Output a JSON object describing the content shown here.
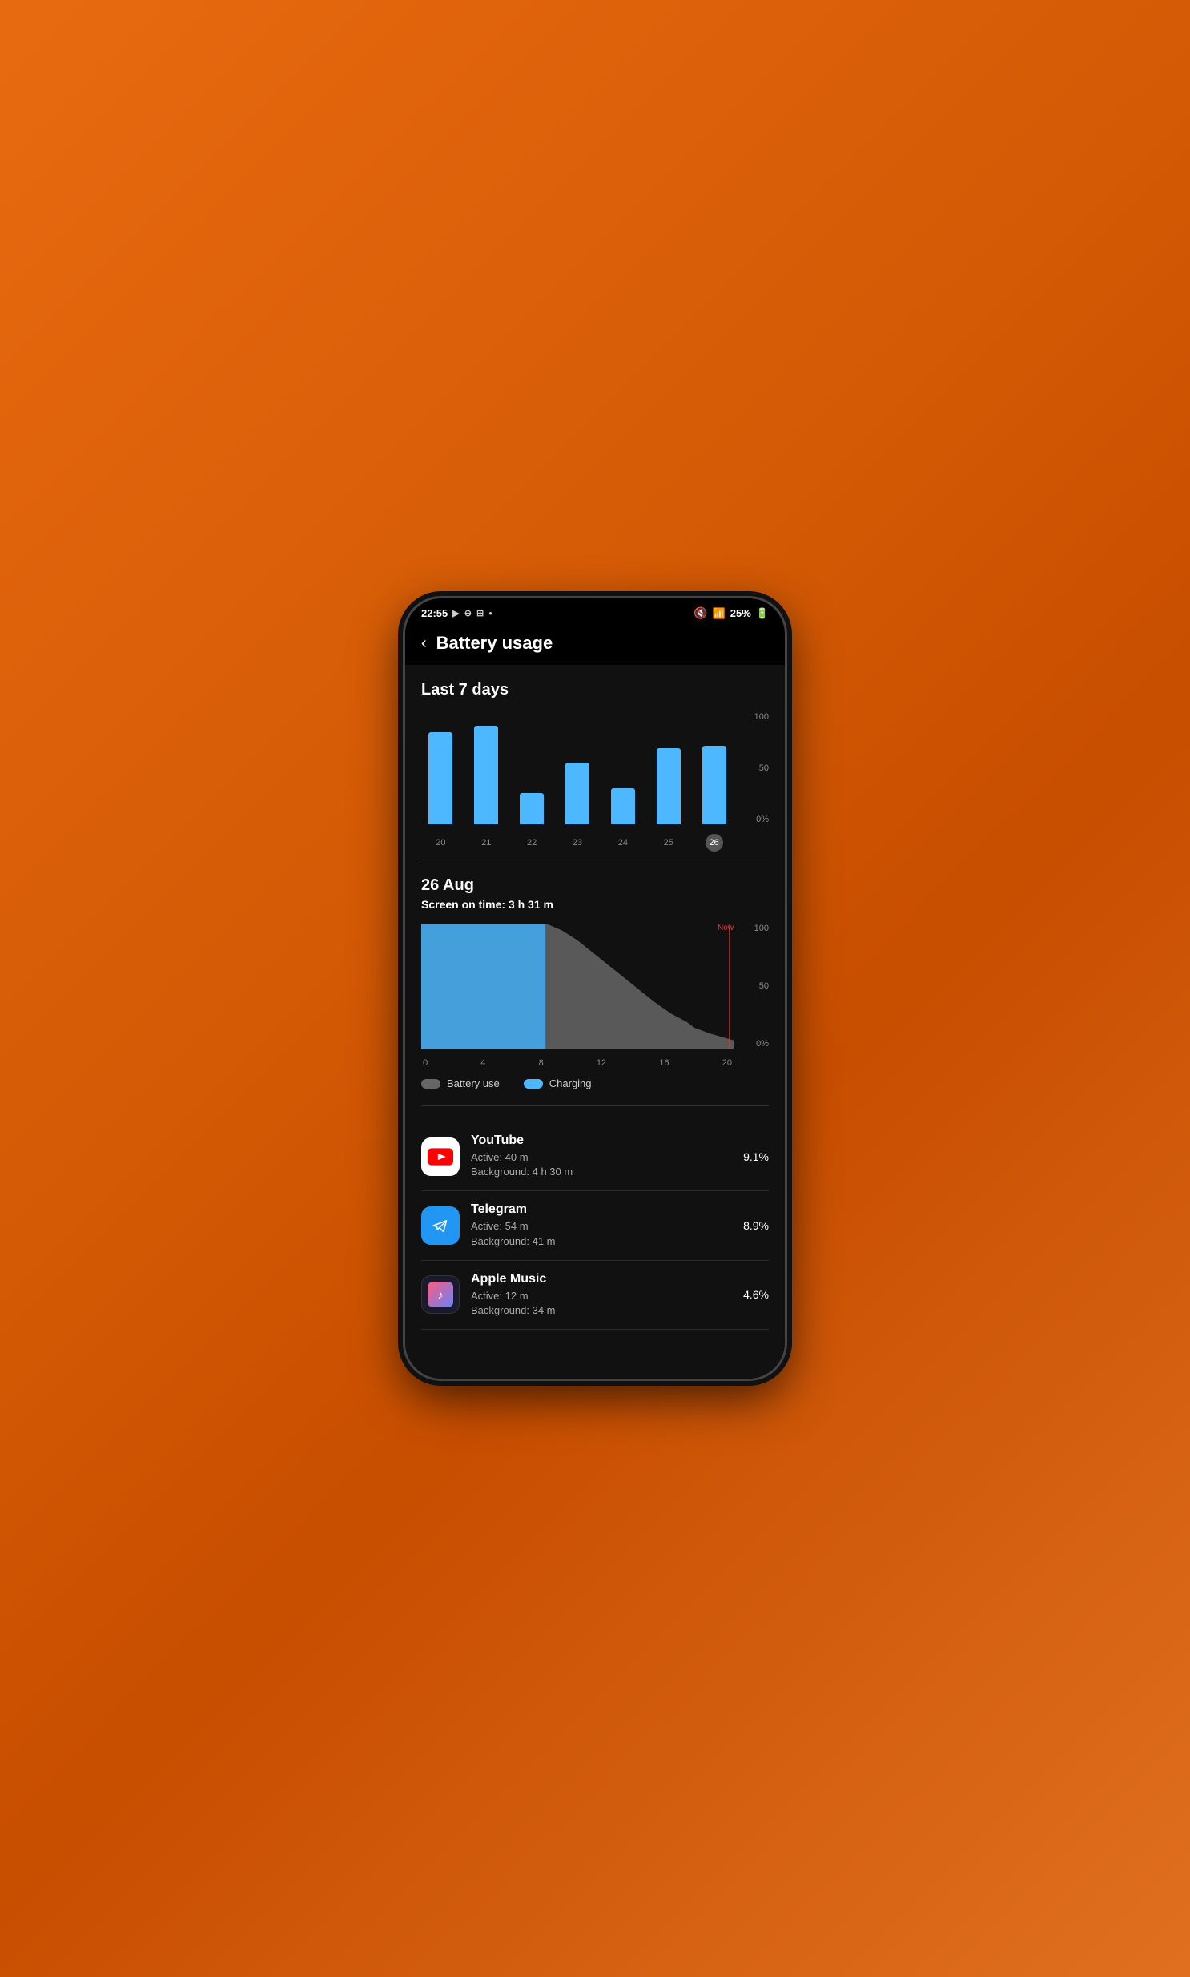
{
  "statusBar": {
    "time": "22:55",
    "battery": "25%",
    "icons": [
      "youtube-icon",
      "dnd-icon",
      "screenrecord-icon",
      "dot-icon"
    ]
  },
  "header": {
    "backLabel": "‹",
    "title": "Battery usage"
  },
  "chart7days": {
    "sectionTitle": "Last 7 days",
    "yLabels": [
      "100",
      "50",
      "0%"
    ],
    "bars": [
      {
        "day": "20",
        "heightPct": 82,
        "selected": false
      },
      {
        "day": "21",
        "heightPct": 88,
        "selected": false
      },
      {
        "day": "22",
        "heightPct": 28,
        "selected": false
      },
      {
        "day": "23",
        "heightPct": 55,
        "selected": false
      },
      {
        "day": "24",
        "heightPct": 32,
        "selected": false
      },
      {
        "day": "25",
        "heightPct": 68,
        "selected": false
      },
      {
        "day": "26",
        "heightPct": 70,
        "selected": true
      }
    ]
  },
  "dayDetail": {
    "date": "26 Aug",
    "screenTime": "Screen on time: 3 h 31 m",
    "xLabels": [
      "0",
      "4",
      "8",
      "12",
      "16",
      "20"
    ],
    "yLabels": [
      "100",
      "50",
      "0%"
    ],
    "nowLabel": "Now"
  },
  "legend": {
    "items": [
      {
        "color": "gray",
        "label": "Battery use"
      },
      {
        "color": "blue",
        "label": "Charging"
      }
    ]
  },
  "apps": [
    {
      "name": "YouTube",
      "active": "Active: 40 m",
      "background": "Background: 4 h 30 m",
      "percent": "9.1%",
      "iconType": "youtube"
    },
    {
      "name": "Telegram",
      "active": "Active: 54 m",
      "background": "Background: 41 m",
      "percent": "8.9%",
      "iconType": "telegram"
    },
    {
      "name": "Apple Music",
      "active": "Active: 12 m",
      "background": "Background: 34 m",
      "percent": "4.6%",
      "iconType": "apple-music"
    }
  ]
}
